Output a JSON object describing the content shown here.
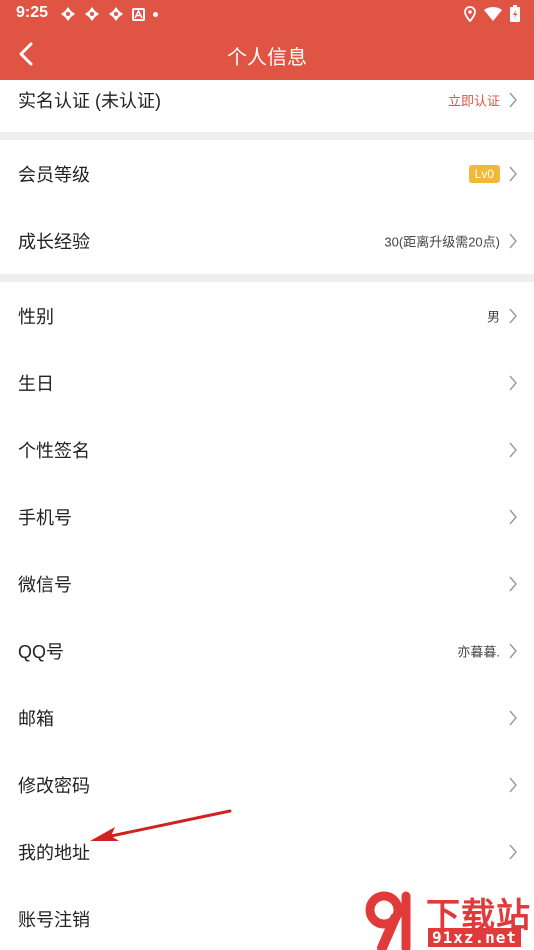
{
  "status_bar": {
    "time": "9:25"
  },
  "header": {
    "title": "个人信息"
  },
  "rows": {
    "realname": {
      "label": "实名认证 (未认证)",
      "value": "立即认证"
    },
    "level": {
      "label": "会员等级",
      "badge": "Lv0"
    },
    "growth": {
      "label": "成长经验",
      "value": "30(距离升级需20点)"
    },
    "gender": {
      "label": "性别",
      "value": "男"
    },
    "birthday": {
      "label": "生日"
    },
    "signature": {
      "label": "个性签名"
    },
    "phone": {
      "label": "手机号"
    },
    "wechat": {
      "label": "微信号"
    },
    "qq": {
      "label": "QQ号",
      "value": "亦暮暮."
    },
    "email": {
      "label": "邮箱"
    },
    "password": {
      "label": "修改密码"
    },
    "address": {
      "label": "我的地址"
    },
    "cancel": {
      "label": "账号注销"
    }
  },
  "watermark": {
    "brand": "下载站",
    "site": "91xz.net"
  },
  "colors": {
    "header": "#e05444",
    "badge": "#f0b93a",
    "accent_red": "#e05444"
  }
}
